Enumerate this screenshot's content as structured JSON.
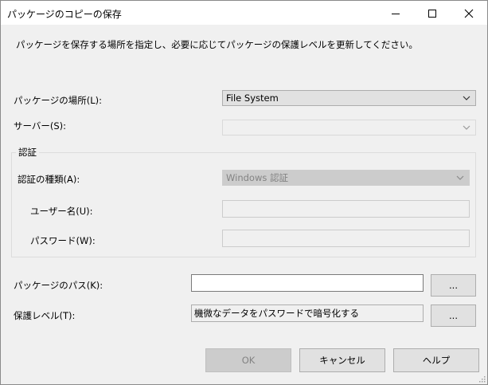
{
  "window": {
    "title": "パッケージのコピーの保存"
  },
  "description": "パッケージを保存する場所を指定し、必要に応じてパッケージの保護レベルを更新してください。",
  "location": {
    "label": "パッケージの場所(L):",
    "value": "File System"
  },
  "server": {
    "label": "サーバー(S):",
    "value": ""
  },
  "authentication": {
    "group_label": "認証",
    "type_label": "認証の種類(A):",
    "type_value": "Windows 認証",
    "username_label": "ユーザー名(U):",
    "username_value": "",
    "password_label": "パスワード(W):",
    "password_value": ""
  },
  "package_path": {
    "label": "パッケージのパス(K):",
    "value": "",
    "browse_label": "..."
  },
  "protection": {
    "label": "保護レベル(T):",
    "value": "機微なデータをパスワードで暗号化する",
    "browse_label": "..."
  },
  "buttons": {
    "ok": "OK",
    "cancel": "キャンセル",
    "help": "ヘルプ"
  }
}
